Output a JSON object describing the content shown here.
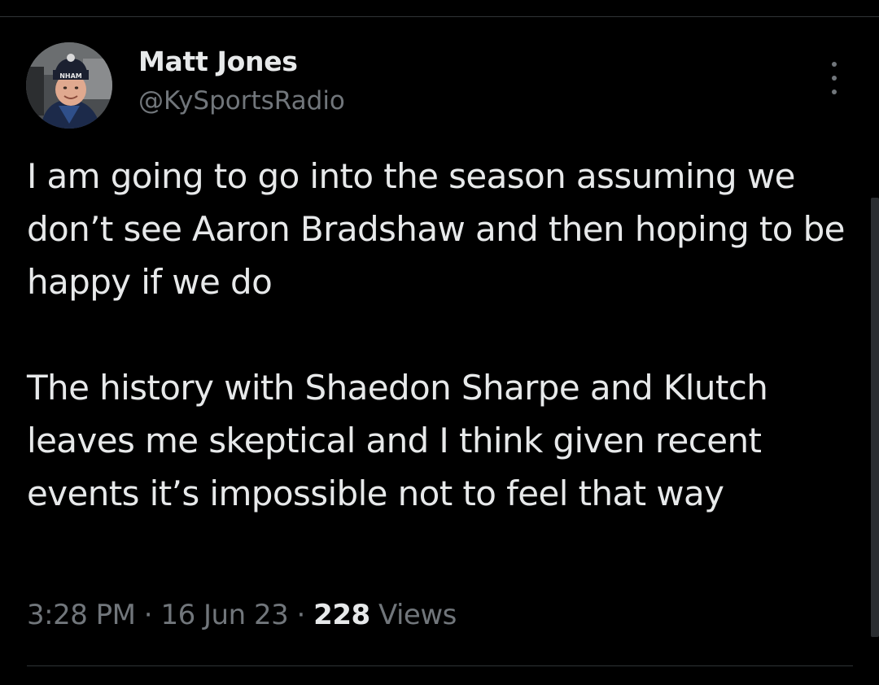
{
  "author": {
    "display_name": "Matt Jones",
    "handle": "@KySportsRadio",
    "avatar_icon": "profile-photo-icon",
    "avatar_hat_text": "NHAM"
  },
  "tweet": {
    "paragraph_1": "I am going to go into the season assuming we don’t see Aaron Bradshaw and then hoping to be happy if we do",
    "paragraph_2": "The history with Shaedon Sharpe and Klutch leaves me skeptical and I think given recent events it’s impossible not to feel that way"
  },
  "meta": {
    "time": "3:28 PM",
    "separator": " · ",
    "date": "16 Jun 23",
    "views_count": "228",
    "views_label": " Views"
  },
  "more_icon": "more-options-icon",
  "colors": {
    "background": "#000000",
    "primary_text": "#e7e9ea",
    "secondary_text": "#71767b",
    "divider": "#2f3336"
  }
}
